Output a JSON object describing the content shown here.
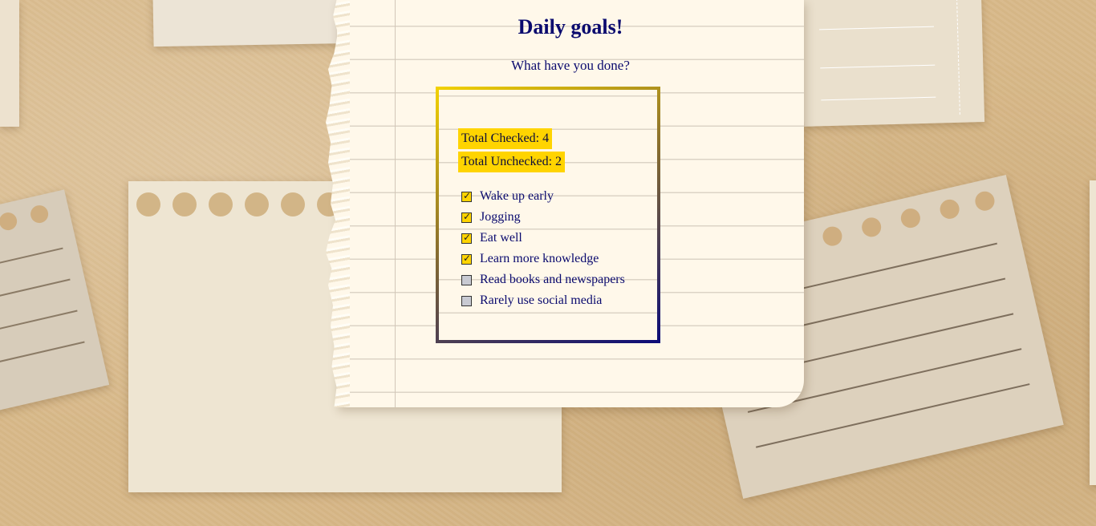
{
  "page": {
    "title": "Daily goals!",
    "subtitle": "What have you done?"
  },
  "stats": {
    "checked_label": "Total Checked: 4",
    "unchecked_label": "Total Unchecked: 2"
  },
  "goals": [
    {
      "label": "Wake up early",
      "checked": true
    },
    {
      "label": "Jogging",
      "checked": true
    },
    {
      "label": "Eat well",
      "checked": true
    },
    {
      "label": "Learn more knowledge",
      "checked": true
    },
    {
      "label": "Read books and newspapers",
      "checked": false
    },
    {
      "label": "Rarely use social media",
      "checked": false
    }
  ],
  "colors": {
    "accent_yellow": "#ffd400",
    "text_navy": "#0a0a6e",
    "unchecked_gray": "#c8cad2"
  }
}
